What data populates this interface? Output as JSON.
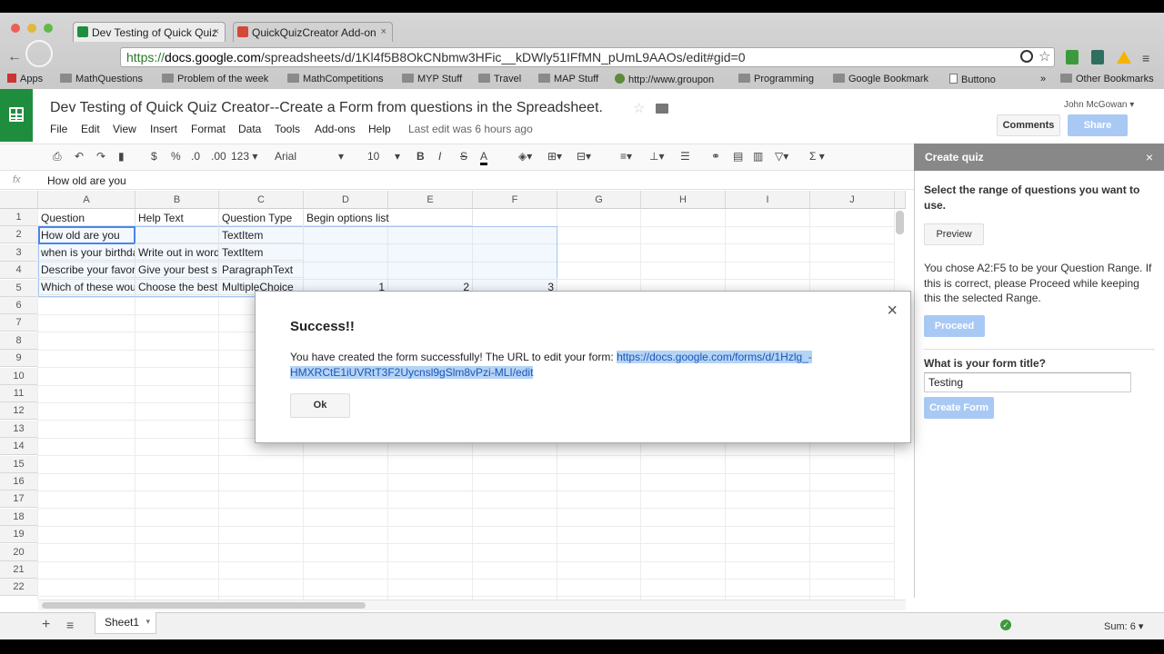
{
  "browser": {
    "tabs": [
      {
        "label": "Dev Testing of Quick Quiz",
        "close": "×"
      },
      {
        "label": "QuickQuizCreator Add-on",
        "close": "×"
      }
    ],
    "url_prefix": "https://",
    "url_host": "docs.google.com",
    "url_path": "/spreadsheets/d/1Kl4f5B8OkCNbmw3HFic__kDWly51IFfMN_pUmL9AAOs/edit#gid=0",
    "bookmarks": [
      "Apps",
      "MathQuestions",
      "Problem of the week",
      "MathCompetitions",
      "MYP Stuff",
      "Travel",
      "MAP Stuff",
      "http://www.groupon",
      "Programming",
      "Google Bookmark",
      "Buttono",
      "»",
      "Other Bookmarks"
    ]
  },
  "doc": {
    "title": "Dev Testing of Quick Quiz Creator--Create a Form from questions in the Spreadsheet.",
    "menus": [
      "File",
      "Edit",
      "View",
      "Insert",
      "Format",
      "Data",
      "Tools",
      "Add-ons",
      "Help"
    ],
    "last_edit": "Last edit was 6 hours ago",
    "user": "John McGowan",
    "comments_label": "Comments",
    "share_label": "Share"
  },
  "toolbar": {
    "currency": "$",
    "percent": "%",
    "dec_less": ".0",
    "dec_more": ".00",
    "format_more": "123",
    "font": "Arial",
    "font_size": "10",
    "bold": "B",
    "italic": "I",
    "strike": "S",
    "textcolor": "A",
    "sigma": "Σ"
  },
  "formula": {
    "fx": "fx",
    "value": "How old are you"
  },
  "grid": {
    "columns": [
      "A",
      "B",
      "C",
      "D",
      "E",
      "F",
      "G",
      "H",
      "I",
      "J"
    ],
    "rows": [
      "1",
      "2",
      "3",
      "4",
      "5",
      "6",
      "7",
      "8",
      "9",
      "10",
      "11",
      "12",
      "13",
      "14",
      "15",
      "16",
      "17",
      "18",
      "19",
      "20",
      "21",
      "22"
    ],
    "cells": {
      "r1": [
        "Question",
        "Help Text",
        "Question Type",
        "Begin options list"
      ],
      "r2": [
        "How old are you",
        "",
        "TextItem"
      ],
      "r3": [
        "when is your birthday",
        "Write out in words",
        "TextItem"
      ],
      "r4": [
        "Describe your favorite",
        "Give your best s",
        "ParagraphText"
      ],
      "r5": [
        "Which of these would",
        "Choose the best",
        "MultipleChoice",
        "1",
        "2",
        "3"
      ]
    }
  },
  "panel": {
    "title": "Create quiz",
    "close": "×",
    "instruction": "Select the range of questions you want to use.",
    "preview_label": "Preview",
    "range_msg": "You chose A2:F5 to be your Question Range. If this is correct, please Proceed while keeping this the selected Range.",
    "proceed_label": "Proceed",
    "form_title_label": "What is your form title?",
    "form_title_value": "Testing",
    "create_label": "Create Form"
  },
  "dialog": {
    "title": "Success!!",
    "message": "You have created the form successfully! The URL to edit your form:",
    "link": "https://docs.google.com/forms/d/1Hzlg_-HMXRCtE1iUVRtT3F2Uycnsl9gSlm8vPzi-MLI/edit",
    "ok_label": "Ok",
    "close": "×"
  },
  "footer": {
    "add": "+",
    "sheet_tab": "Sheet1",
    "sum": "Sum: 6"
  }
}
